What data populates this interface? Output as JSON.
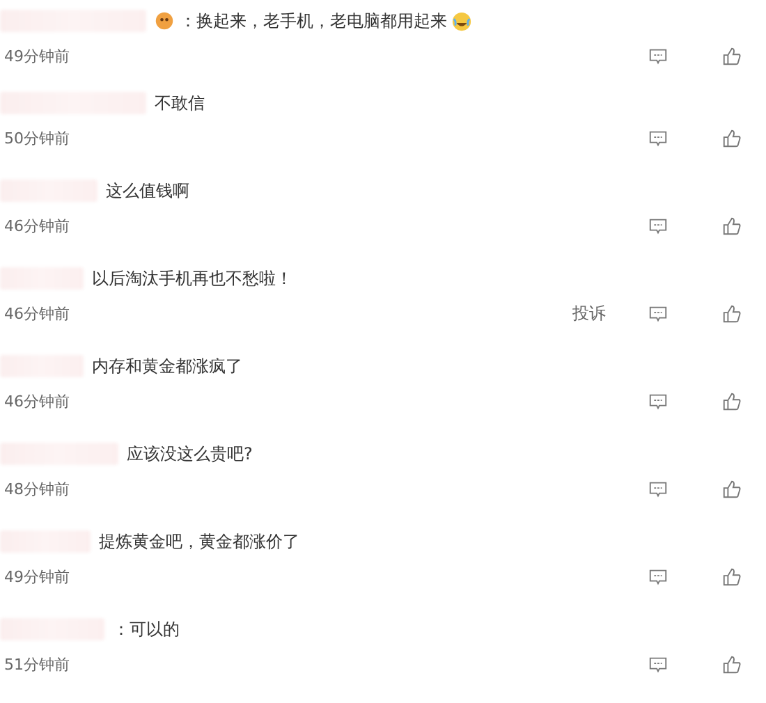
{
  "comments": [
    {
      "text": "：换起来，老手机，老电脑都用起来",
      "time": "49分钟前",
      "badge_emoji": true,
      "trailing_emoji": true
    },
    {
      "text": "不敢信",
      "time": "50分钟前",
      "badge_emoji": false,
      "trailing_emoji": false
    },
    {
      "text": "这么值钱啊",
      "time": "46分钟前",
      "badge_emoji": false,
      "trailing_emoji": false
    },
    {
      "text": "以后淘汰手机再也不愁啦！",
      "time": "46分钟前",
      "badge_emoji": false,
      "trailing_emoji": false,
      "report": "投诉"
    },
    {
      "text": "内存和黄金都涨疯了",
      "time": "46分钟前",
      "badge_emoji": false,
      "trailing_emoji": false
    },
    {
      "text": "应该没这么贵吧?",
      "time": "48分钟前",
      "badge_emoji": false,
      "trailing_emoji": false
    },
    {
      "text": "提炼黄金吧，黄金都涨价了",
      "time": "49分钟前",
      "badge_emoji": false,
      "trailing_emoji": false
    },
    {
      "text": "：可以的",
      "time": "51分钟前",
      "badge_emoji": false,
      "trailing_emoji": false
    }
  ]
}
